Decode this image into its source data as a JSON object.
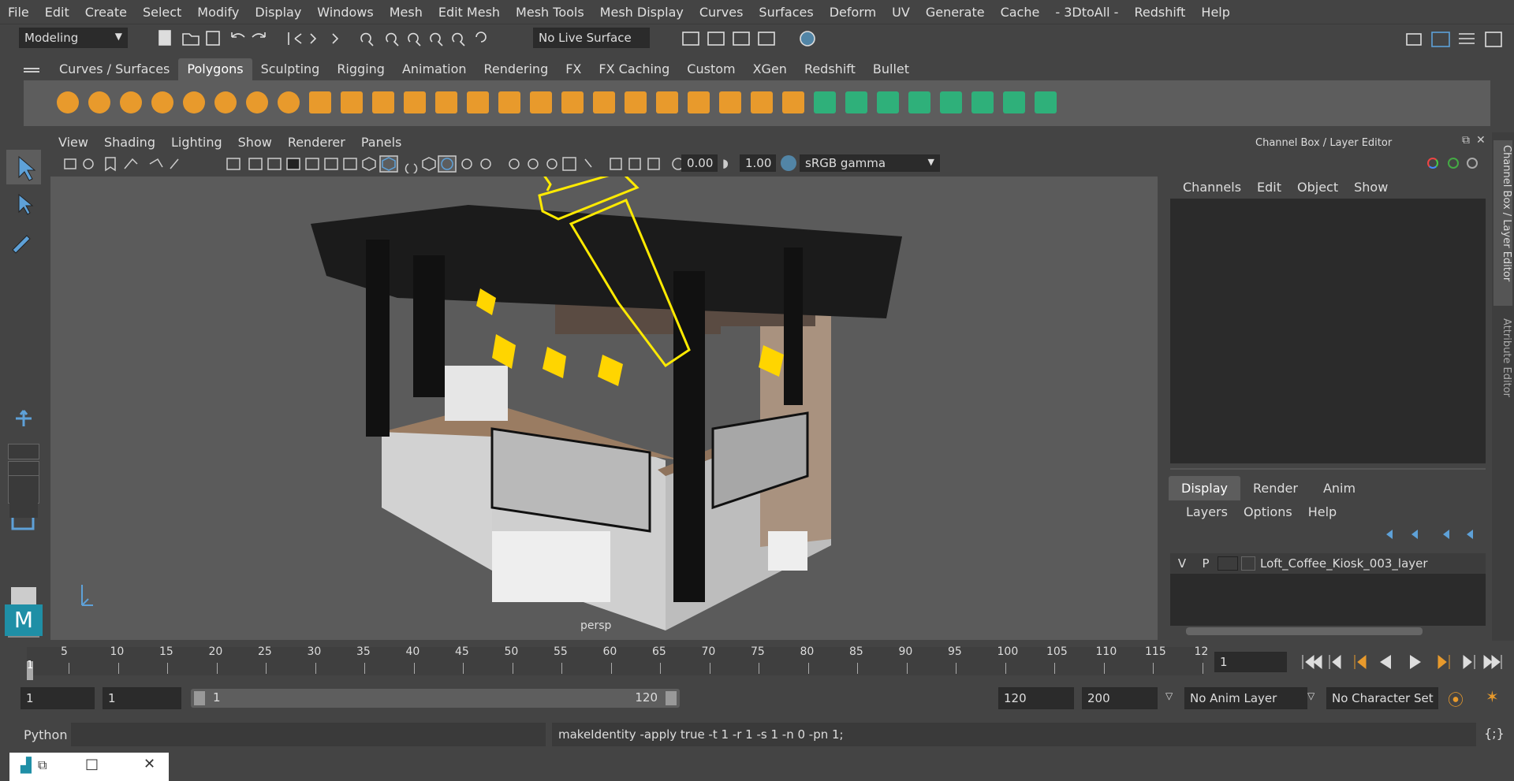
{
  "menubar": {
    "items": [
      "File",
      "Edit",
      "Create",
      "Select",
      "Modify",
      "Display",
      "Windows",
      "Mesh",
      "Edit Mesh",
      "Mesh Tools",
      "Mesh Display",
      "Curves",
      "Surfaces",
      "Deform",
      "UV",
      "Generate",
      "Cache",
      "- 3DtoAll -",
      "Redshift",
      "Help"
    ]
  },
  "status": {
    "mode": "Modeling",
    "live_surface": "No Live Surface"
  },
  "shelf": {
    "tabs": [
      "Curves / Surfaces",
      "Polygons",
      "Sculpting",
      "Rigging",
      "Animation",
      "Rendering",
      "FX",
      "FX Caching",
      "Custom",
      "XGen",
      "Redshift",
      "Bullet"
    ],
    "active_tab": "Polygons"
  },
  "viewport": {
    "menu": [
      "View",
      "Shading",
      "Lighting",
      "Show",
      "Renderer",
      "Panels"
    ],
    "exposure": "0.00",
    "gamma": "1.00",
    "colorspace": "sRGB gamma",
    "camera_label": "persp"
  },
  "channelbox": {
    "title": "Channel Box / Layer Editor",
    "menu": [
      "Channels",
      "Edit",
      "Object",
      "Show"
    ],
    "layer_tabs": [
      "Display",
      "Render",
      "Anim"
    ],
    "active_layer_tab": "Display",
    "layer_menu": [
      "Layers",
      "Options",
      "Help"
    ],
    "layer": {
      "v": "V",
      "p": "P",
      "name": "Loft_Coffee_Kiosk_003_layer"
    },
    "side_tabs": [
      "Channel Box / Layer Editor",
      "Attribute Editor"
    ]
  },
  "timeline": {
    "ticks": [
      "5",
      "10",
      "15",
      "20",
      "25",
      "30",
      "35",
      "40",
      "45",
      "50",
      "55",
      "60",
      "65",
      "70",
      "75",
      "80",
      "85",
      "90",
      "95",
      "100",
      "105",
      "110",
      "115",
      "12"
    ],
    "current_marker": "1",
    "current_frame": "1"
  },
  "range": {
    "start": "1",
    "inner_start": "1",
    "slider_start": "1",
    "slider_end": "120",
    "end": "120",
    "max": "200",
    "anim_layer": "No Anim Layer",
    "character_set": "No Character Set"
  },
  "cmdline": {
    "lang": "Python",
    "result": "makeIdentity -apply true -t 1 -r 1 -s 1 -n 0 -pn 1;"
  },
  "colors": {
    "accent": "#5285a6",
    "selection_yellow": "#ffea00",
    "shelf_orange": "#e89a2c",
    "shelf_green": "#2fb07a"
  }
}
